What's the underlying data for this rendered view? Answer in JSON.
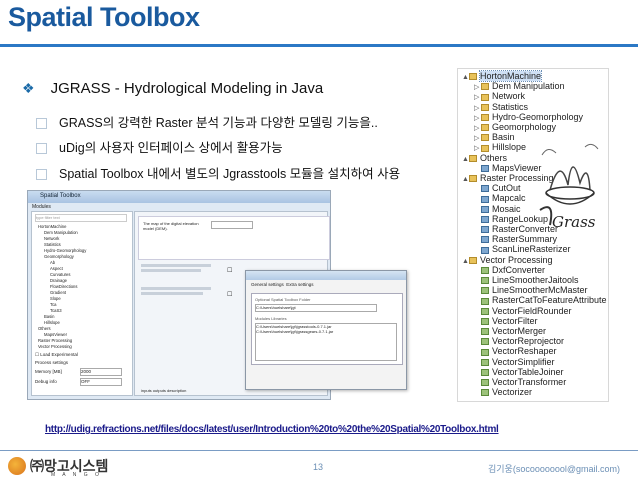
{
  "slide": {
    "title": "Spatial Toolbox",
    "main_bullet": "JGRASS - Hydrological Modeling in Java",
    "sub_bullets": [
      "GRASS의 강력한 Raster 분석 기능과 다양한 모델링 기능을..",
      "uDig의 사용자 인터페이스 상에서 활용가능",
      "Spatial Toolbox 내에서 별도의 Jgrasstools 모듈을 설치하여 사용"
    ],
    "url": "http://udig.refractions.net/files/docs/latest/user/Introduction%20to%20the%20Spatial%20Toolbox.html",
    "page_number": "13",
    "author": "김기웅(socoooooool@gmail.com)",
    "company_logo_text": "㈜망고시스템",
    "company_logo_sub": "M A N G O"
  },
  "tree": {
    "items": [
      {
        "label": "HortonMachine",
        "indent": 0,
        "kind": "folder",
        "expander": "▲",
        "selected": true
      },
      {
        "label": "Dem Manipulation",
        "indent": 1,
        "kind": "folder",
        "expander": "▷"
      },
      {
        "label": "Network",
        "indent": 1,
        "kind": "folder",
        "expander": "▷"
      },
      {
        "label": "Statistics",
        "indent": 1,
        "kind": "folder",
        "expander": "▷"
      },
      {
        "label": "Hydro-Geomorphology",
        "indent": 1,
        "kind": "folder",
        "expander": "▷"
      },
      {
        "label": "Geomorphology",
        "indent": 1,
        "kind": "folder",
        "expander": "▷"
      },
      {
        "label": "Basin",
        "indent": 1,
        "kind": "folder",
        "expander": "▷"
      },
      {
        "label": "Hillslope",
        "indent": 1,
        "kind": "folder",
        "expander": "▷"
      },
      {
        "label": "Others",
        "indent": 0,
        "kind": "folder",
        "expander": "▲"
      },
      {
        "label": "MapsViewer",
        "indent": 1,
        "kind": "tool",
        "expander": ""
      },
      {
        "label": "Raster Processing",
        "indent": 0,
        "kind": "folder",
        "expander": "▲"
      },
      {
        "label": "CutOut",
        "indent": 1,
        "kind": "tool",
        "expander": ""
      },
      {
        "label": "Mapcalc",
        "indent": 1,
        "kind": "tool",
        "expander": ""
      },
      {
        "label": "Mosaic",
        "indent": 1,
        "kind": "tool",
        "expander": ""
      },
      {
        "label": "RangeLookup",
        "indent": 1,
        "kind": "tool",
        "expander": ""
      },
      {
        "label": "RasterConverter",
        "indent": 1,
        "kind": "tool",
        "expander": ""
      },
      {
        "label": "RasterSummary",
        "indent": 1,
        "kind": "tool",
        "expander": ""
      },
      {
        "label": "ScanLineRasterizer",
        "indent": 1,
        "kind": "tool",
        "expander": ""
      },
      {
        "label": "Vector Processing",
        "indent": 0,
        "kind": "folder",
        "expander": "▲"
      },
      {
        "label": "DxfConverter",
        "indent": 1,
        "kind": "tool2",
        "expander": ""
      },
      {
        "label": "LineSmootherJaitools",
        "indent": 1,
        "kind": "tool2",
        "expander": ""
      },
      {
        "label": "LineSmootherMcMaster",
        "indent": 1,
        "kind": "tool2",
        "expander": ""
      },
      {
        "label": "RasterCatToFeatureAttribute",
        "indent": 1,
        "kind": "tool2",
        "expander": ""
      },
      {
        "label": "VectorFieldRounder",
        "indent": 1,
        "kind": "tool2",
        "expander": ""
      },
      {
        "label": "VectorFilter",
        "indent": 1,
        "kind": "tool2",
        "expander": ""
      },
      {
        "label": "VectorMerger",
        "indent": 1,
        "kind": "tool2",
        "expander": ""
      },
      {
        "label": "VectorReprojector",
        "indent": 1,
        "kind": "tool2",
        "expander": ""
      },
      {
        "label": "VectorReshaper",
        "indent": 1,
        "kind": "tool2",
        "expander": ""
      },
      {
        "label": "VectorSimplifier",
        "indent": 1,
        "kind": "tool2",
        "expander": ""
      },
      {
        "label": "VectorTableJoiner",
        "indent": 1,
        "kind": "tool2",
        "expander": ""
      },
      {
        "label": "VectorTransformer",
        "indent": 1,
        "kind": "tool2",
        "expander": ""
      },
      {
        "label": "Vectorizer",
        "indent": 1,
        "kind": "tool2",
        "expander": ""
      }
    ]
  },
  "screenshot": {
    "window_title": "Spatial Toolbox",
    "modules_label": "Modules",
    "filter_placeholder": "type filter text",
    "description_text": "The map of the digital elevation model (DEM).",
    "tree_items": [
      "HortonMachine",
      "Dem Manipulation",
      "Network",
      "Statistics",
      "Hydro-Geomorphology",
      "Geomorphology",
      "Ab",
      "Aspect",
      "Curvatures",
      "Drainage",
      "FlowDirections",
      "Gradient",
      "Slope",
      "Tca",
      "TcaS3",
      "Basin",
      "Hillslope",
      "Others",
      "MapsViewer",
      "Raster Processing",
      "Vector Processing"
    ],
    "load_experimental": "Load Experimental",
    "process_settings": "Process settings",
    "memory_label": "Memory [MB]",
    "memory_value": "2000",
    "debug_label": "Debug info",
    "debug_value": "OFF",
    "tabs": "inputs  outputs  description",
    "dialog_tab1": "General settings",
    "dialog_tab2": "Extra settings",
    "dialog_folder_label": "Optional Spatial Toolbox Folder",
    "dialog_folder_value": "C:\\Users\\huelshare\\jgt",
    "dialog_libs_label": "Modules Libraries",
    "dialog_lib1": "C:\\Users\\huelshare\\jgt\\jgrasstools-0.7.1.jar",
    "dialog_lib2": "C:\\Users\\huelshare\\jgt\\jgrassgears-0.7.1.jar"
  },
  "colors": {
    "title": "#1a5a9e",
    "rule": "#2b78c5",
    "url": "#1a1a8a",
    "footer_text": "#6b8fb5"
  }
}
